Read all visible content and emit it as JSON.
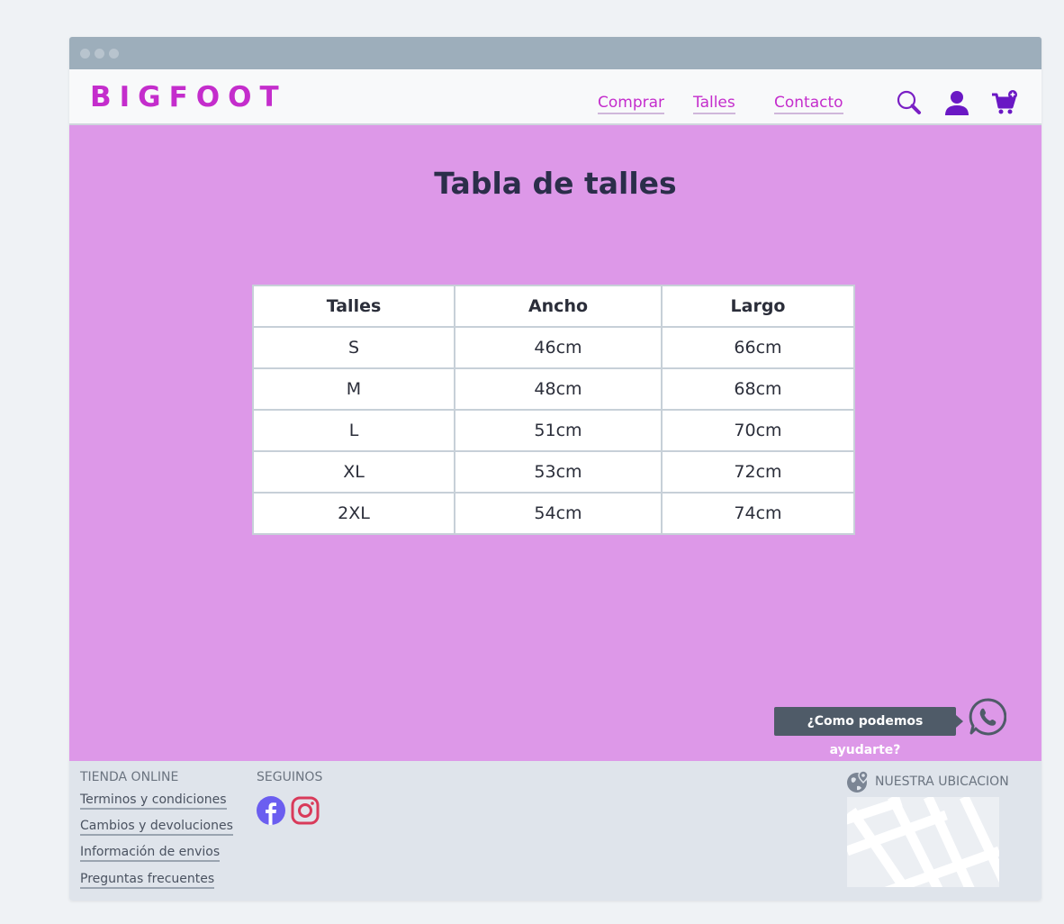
{
  "brand": {
    "logo": "BIGFOOT",
    "accent_color": "#c42dcc",
    "main_bg": "#dd98e8"
  },
  "nav": {
    "links": [
      "Comprar",
      "Talles",
      "Contacto"
    ],
    "icons": [
      "search-icon",
      "user-icon",
      "cart-add-icon"
    ]
  },
  "page": {
    "title": "Tabla de talles"
  },
  "size_table": {
    "headers": [
      "Talles",
      "Ancho",
      "Largo"
    ],
    "rows": [
      [
        "S",
        "46cm",
        "66cm"
      ],
      [
        "M",
        "48cm",
        "68cm"
      ],
      [
        "L",
        "51cm",
        "70cm"
      ],
      [
        "XL",
        "53cm",
        "72cm"
      ],
      [
        "2XL",
        "54cm",
        "74cm"
      ]
    ]
  },
  "help": {
    "label": "¿Como podemos ayudarte?",
    "icon": "whatsapp-icon"
  },
  "footer": {
    "tienda_heading": "TIENDA ONLINE",
    "links": [
      "Terminos y condiciones",
      "Cambios y devoluciones",
      "Información de envios",
      "Preguntas frecuentes"
    ],
    "seguinos_heading": "SEGUINOS",
    "social_icons": [
      "facebook-icon",
      "instagram-icon"
    ],
    "ubicacion_heading": "NUESTRA UBICACION"
  }
}
